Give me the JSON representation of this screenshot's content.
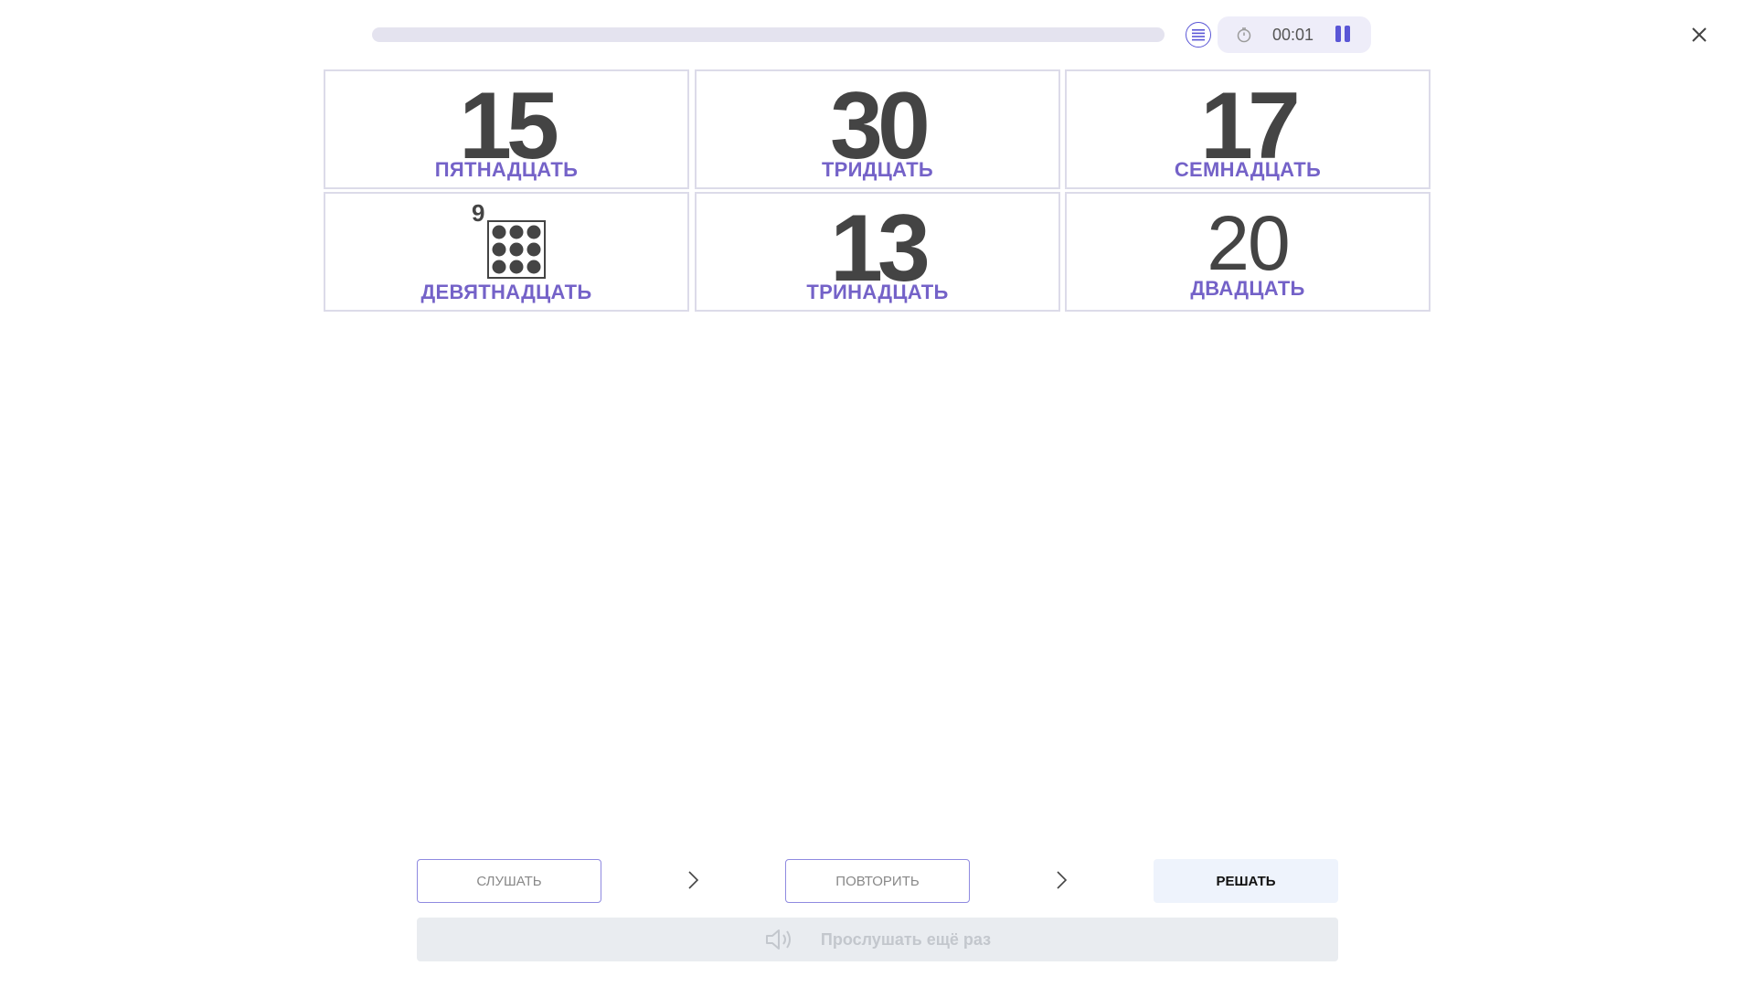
{
  "header": {
    "progress_percent": 0,
    "timer": "00:01",
    "icons": {
      "menu": "list-icon",
      "timer": "stopwatch-icon",
      "pause": "pause-icon",
      "close": "close-icon"
    }
  },
  "cards": [
    {
      "number": "15",
      "word": "ПЯТНАДЦАТЬ"
    },
    {
      "number": "30",
      "word": "ТРИДЦАТЬ"
    },
    {
      "number": "17",
      "word": "СЕМНАДЦАТЬ"
    },
    {
      "number": "9",
      "word": "ДЕВЯТНАДЦАТЬ",
      "dots_count": 9
    },
    {
      "number": "13",
      "word": "ТРИНАДЦАТЬ"
    },
    {
      "number": "20",
      "word": "ДВАДЦАТЬ"
    }
  ],
  "steps": {
    "listen": "СЛУШАТЬ",
    "repeat": "ПОВТОРИТЬ",
    "solve": "РЕШАТЬ"
  },
  "listen_again": "Прослушать ещё раз",
  "colors": {
    "accent": "#5a56d6",
    "word": "#7462c8",
    "number": "#444444"
  }
}
